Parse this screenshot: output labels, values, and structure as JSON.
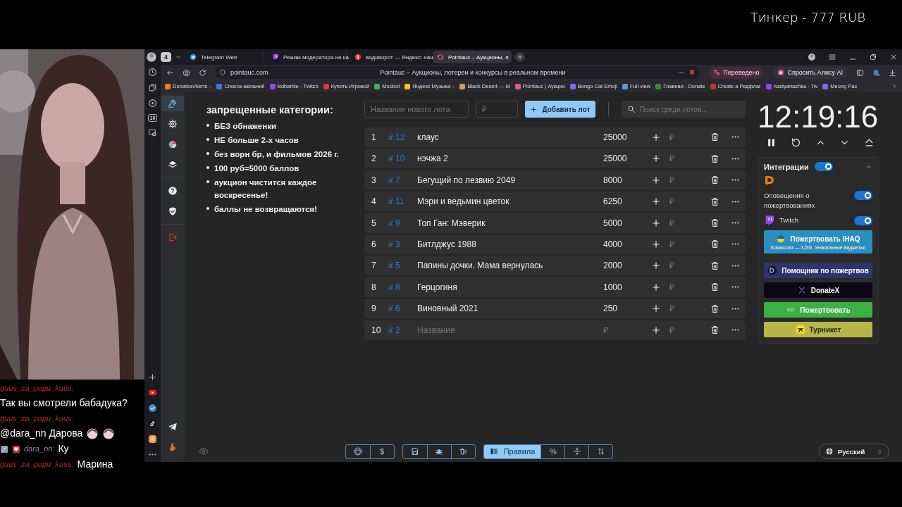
{
  "overlay": {
    "donation_text": "Тинкер - 777 RUB"
  },
  "chat": {
    "messages": [
      {
        "user": "guus_za_popu_kuus:",
        "color": "#b3262b",
        "text": "Так вы смотрели бабадука?"
      },
      {
        "user": "guus_za_popu_kuus:",
        "color": "#b3262b",
        "text": "@dara_nn Дарова",
        "emotes": [
          {
            "kind": "emote"
          },
          {
            "kind": "emote"
          }
        ]
      },
      {
        "user": "dara_nn:",
        "color": "#7f95a8",
        "badges": [
          {
            "kind": "sword"
          },
          {
            "kind": "heart"
          }
        ],
        "text": "Ку"
      },
      {
        "user": "guus_za_popu_kuus:",
        "color": "#b3262b",
        "text": "Марина"
      }
    ]
  },
  "browser": {
    "tab_count": "4",
    "tabs": [
      {
        "title": "Telegram Web",
        "kind": "telegram",
        "selected": false
      },
      {
        "title": "Режим модератора на ка",
        "kind": "twitch",
        "selected": false
      },
      {
        "title": "водоворот — Яндекс: наш",
        "kind": "yandex",
        "selected": false
      },
      {
        "title": "Pointauc – Аукционы, л",
        "kind": "pointauc",
        "selected": true
      }
    ],
    "url": "pointauc.com",
    "page_title": "Pointauc – Аукционы, лотереи и конкурсы в реальном времени",
    "translate_label": "Переведено",
    "assistant_label": "Спросить Алису AI",
    "bookmarks": [
      {
        "title": "DonationAlerts –",
        "color": "#f57d07"
      },
      {
        "title": "Список желаний",
        "color": "#2f7fe0"
      },
      {
        "title": "kidbarbie - Twitch",
        "color": "#9146ff"
      },
      {
        "title": "Купить Игровой",
        "color": "#e0343c"
      },
      {
        "title": "Moobot",
        "color": "#3fae5a"
      },
      {
        "title": "Яндекс Музыка –",
        "color": "#f5c518"
      },
      {
        "title": "Black Desert — M",
        "color": "#c9a25a"
      },
      {
        "title": "Pointauc | Аукцио",
        "color": "#e05a9a"
      },
      {
        "title": "Bongo Cat Emoji",
        "color": "#7b6cf0"
      },
      {
        "title": "Full view",
        "color": "#5a9ad6"
      },
      {
        "title": "Главная - Donate",
        "color": "#3a8a3a"
      },
      {
        "title": "Create a Редфлаг",
        "color": "#c0392b"
      },
      {
        "title": "nastyanashka - Tw",
        "color": "#9146ff"
      },
      {
        "title": "Meong Pac",
        "color": "#7b6cf0"
      }
    ],
    "sidebar_top": [
      {
        "kind": "clock"
      },
      {
        "kind": "collections"
      },
      {
        "kind": "play"
      },
      {
        "kind": "counter",
        "label": "10"
      },
      {
        "kind": "screen"
      }
    ],
    "sidebar_bottom": [
      {
        "kind": "plus"
      },
      {
        "kind": "youtube"
      },
      {
        "kind": "verified"
      },
      {
        "kind": "tiktok"
      },
      {
        "kind": "app"
      },
      {
        "kind": "more"
      }
    ]
  },
  "app_sidebar": {
    "nav": [
      {
        "kind": "gavel",
        "selected": true
      },
      {
        "kind": "gear",
        "selected": false
      },
      {
        "kind": "pie",
        "selected": false
      },
      {
        "kind": "layers",
        "selected": false
      },
      {
        "kind": "divider"
      },
      {
        "kind": "help",
        "selected": false
      },
      {
        "kind": "shield",
        "selected": false
      },
      {
        "kind": "divider"
      },
      {
        "kind": "logout",
        "selected": false
      }
    ],
    "bottom": [
      {
        "kind": "telegram"
      },
      {
        "kind": "boosty"
      }
    ]
  },
  "rules": {
    "title": "запрещенные категории:",
    "items": [
      "БЕЗ обнаженки",
      "НЕ больше 2-х часов",
      "без ворн бр, и фильмов 2026 г.",
      "100 руб=5000 баллов",
      "аукцион чистится каждое воскресенье!",
      "баллы не возвращаются!"
    ]
  },
  "new_lot": {
    "name_placeholder": "Название нового лота",
    "amount_placeholder": "₽",
    "add_button": "Добавить лот",
    "search_placeholder": "Поиск среди лотов..."
  },
  "lots": [
    {
      "num": "1",
      "id": "# 12",
      "name": "клаус",
      "amount": "25000",
      "add_placeholder": "₽"
    },
    {
      "num": "2",
      "id": "# 10",
      "name": "нэчжа 2",
      "amount": "25000",
      "add_placeholder": "₽"
    },
    {
      "num": "3",
      "id": "# 7",
      "name": "Бегущий по лезвию 2049",
      "amount": "8000",
      "add_placeholder": "₽"
    },
    {
      "num": "4",
      "id": "# 11",
      "name": "Мэри и ведьмин цветок",
      "amount": "6250",
      "add_placeholder": "₽"
    },
    {
      "num": "5",
      "id": "# 9",
      "name": "Топ Ган: Мэверик",
      "amount": "5000",
      "add_placeholder": "₽"
    },
    {
      "num": "6",
      "id": "# 3",
      "name": "Битлджус 1988",
      "amount": "4000",
      "add_placeholder": "₽"
    },
    {
      "num": "7",
      "id": "# 5",
      "name": "Папины дочки. Мама вернулась",
      "amount": "2000",
      "add_placeholder": "₽"
    },
    {
      "num": "8",
      "id": "# 8",
      "name": "Герцогиня",
      "amount": "1000",
      "add_placeholder": "₽"
    },
    {
      "num": "9",
      "id": "# 6",
      "name": "Виновный 2021",
      "amount": "250",
      "add_placeholder": "₽"
    },
    {
      "num": "10",
      "id": "# 2",
      "name_placeholder": "Название",
      "amount_placeholder": "₽",
      "add_placeholder": "₽"
    }
  ],
  "timer": {
    "time": "12:19:16",
    "controls": [
      {
        "kind": "pause"
      },
      {
        "kind": "reset"
      },
      {
        "kind": "up"
      },
      {
        "kind": "down"
      },
      {
        "kind": "eject"
      }
    ]
  },
  "integrations": {
    "title": "Интеграции",
    "on": true,
    "expanded": true,
    "items": [
      {
        "kind": "donationalerts",
        "label": "Оповещения о пожертвованиях",
        "on": true
      },
      {
        "kind": "twitch",
        "label": "Twitch",
        "on": true
      }
    ],
    "donate_buttons": [
      {
        "kind": "ihaq",
        "label": "Пожертвовать IHAQ",
        "subtitle": "Комиссия — 3,5%. Уникальные виджеты!"
      },
      {
        "kind": "dh",
        "label": "Помощник по пожертвов"
      },
      {
        "kind": "donatex",
        "label": "DonateX"
      },
      {
        "kind": "link",
        "label": "Пожертвовать"
      },
      {
        "kind": "turnstile",
        "label": "Турникет"
      }
    ]
  },
  "toolbar": {
    "groups": [
      [
        {
          "kind": "github",
          "selected": false
        },
        {
          "kind": "text",
          "label": "$",
          "selected": false
        }
      ],
      [
        {
          "kind": "save",
          "selected": false
        },
        {
          "kind": "bug",
          "selected": false
        },
        {
          "kind": "clear",
          "selected": false
        }
      ],
      [
        {
          "kind": "rules",
          "label": "Правила",
          "selected": true
        },
        {
          "kind": "text",
          "label": "%",
          "selected": false
        },
        {
          "kind": "split",
          "selected": false
        },
        {
          "kind": "sort",
          "selected": false
        }
      ]
    ],
    "language": "Русский"
  }
}
